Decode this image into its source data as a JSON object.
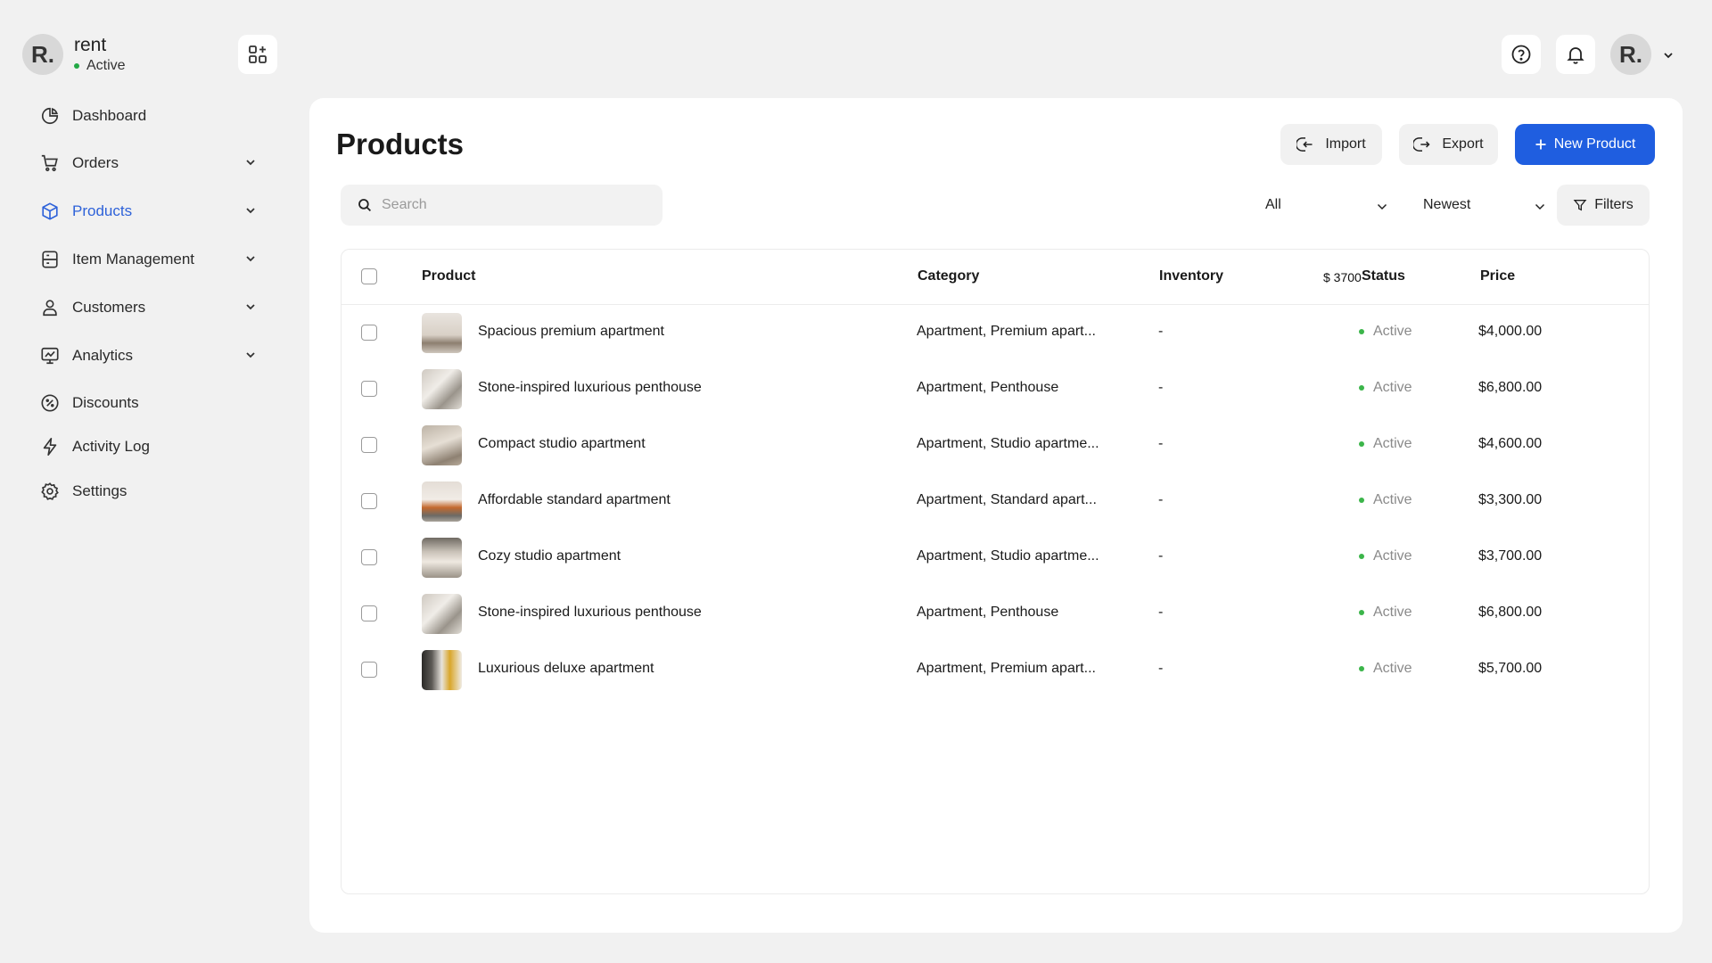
{
  "brand": {
    "initial": "R.",
    "name": "rent",
    "status": "Active"
  },
  "nav": [
    {
      "label": "Dashboard",
      "icon": "pie-chart-icon",
      "has_chevron": false,
      "active": false
    },
    {
      "label": "Orders",
      "icon": "cart-icon",
      "has_chevron": true,
      "active": false
    },
    {
      "label": "Products",
      "icon": "box-icon",
      "has_chevron": true,
      "active": true
    },
    {
      "label": "Item Management",
      "icon": "list-icon",
      "has_chevron": true,
      "active": false
    },
    {
      "label": "Customers",
      "icon": "user-icon",
      "has_chevron": true,
      "active": false
    },
    {
      "label": "Analytics",
      "icon": "monitor-chart-icon",
      "has_chevron": true,
      "active": false
    },
    {
      "label": "Discounts",
      "icon": "discount-icon",
      "has_chevron": false,
      "active": false
    },
    {
      "label": "Activity Log",
      "icon": "lightning-icon",
      "has_chevron": false,
      "active": false
    },
    {
      "label": "Settings",
      "icon": "gear-icon",
      "has_chevron": false,
      "active": false
    }
  ],
  "header": {
    "user_initial": "R."
  },
  "main": {
    "title": "Products",
    "import_label": "Import",
    "export_label": "Export",
    "new_product_label": "New Product",
    "search_placeholder": "Search",
    "filter_all": "All",
    "sort": "Newest",
    "filters_label": "Filters"
  },
  "table": {
    "columns": {
      "product": "Product",
      "category": "Category",
      "inventory": "Inventory",
      "status": "Status",
      "price": "Price"
    },
    "overlap_text": "$ 3700",
    "rows": [
      {
        "name": "Spacious premium apartment",
        "category": "Apartment, Premium apart...",
        "inventory": "-",
        "status": "Active",
        "price": "$4,000.00"
      },
      {
        "name": "Stone-inspired luxurious penthouse",
        "category": "Apartment, Penthouse",
        "inventory": "-",
        "status": "Active",
        "price": "$6,800.00"
      },
      {
        "name": "Compact studio apartment",
        "category": "Apartment, Studio apartme...",
        "inventory": "-",
        "status": "Active",
        "price": "$4,600.00"
      },
      {
        "name": "Affordable standard apartment",
        "category": "Apartment, Standard apart...",
        "inventory": "-",
        "status": "Active",
        "price": "$3,300.00"
      },
      {
        "name": "Cozy studio apartment",
        "category": "Apartment, Studio apartme...",
        "inventory": "-",
        "status": "Active",
        "price": "$3,700.00"
      },
      {
        "name": "Stone-inspired luxurious penthouse",
        "category": "Apartment, Penthouse",
        "inventory": "-",
        "status": "Active",
        "price": "$6,800.00"
      },
      {
        "name": "Luxurious deluxe apartment",
        "category": "Apartment, Premium apart...",
        "inventory": "-",
        "status": "Active",
        "price": "$5,700.00"
      }
    ]
  },
  "colors": {
    "accent": "#1f5ee0",
    "active_nav": "#2e62d9",
    "status_dot": "#3bb54a",
    "background": "#f1f1f1"
  }
}
